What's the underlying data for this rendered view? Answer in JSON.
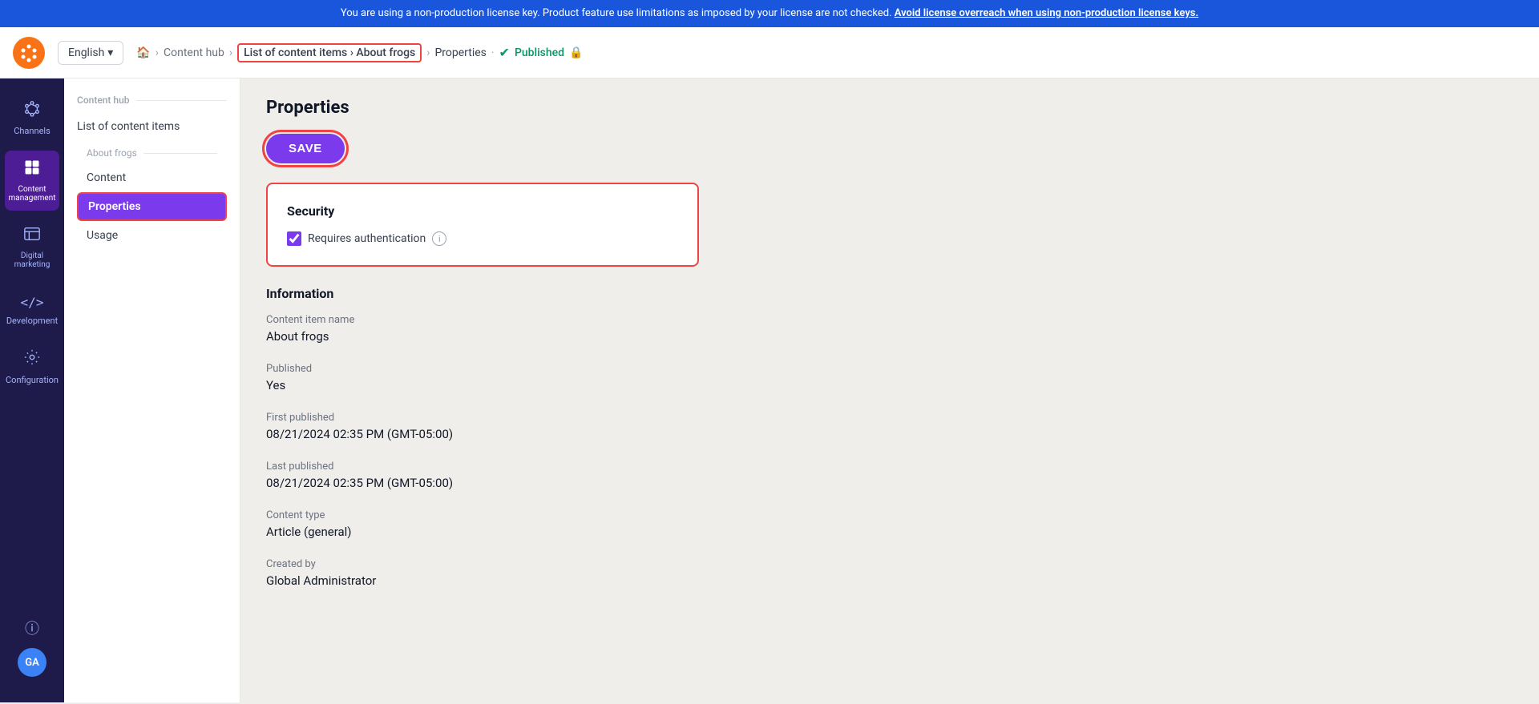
{
  "banner": {
    "text": "You are using a non-production license key. Product feature use limitations as imposed by your license are not checked.",
    "link_text": "Avoid license overreach when using non-production license keys."
  },
  "header": {
    "lang": "English",
    "lang_chevron": "▾",
    "breadcrumb": [
      {
        "label": "🏠",
        "type": "home"
      },
      {
        "label": "Content hub",
        "type": "link"
      },
      {
        "label": "List of content items",
        "type": "highlighted"
      },
      {
        "label": "About frogs",
        "type": "highlighted"
      },
      {
        "label": "Properties",
        "type": "current"
      }
    ],
    "published_label": "Published",
    "lock_icon": "🔒"
  },
  "sidebar": {
    "items": [
      {
        "id": "channels",
        "label": "Channels",
        "icon": "⊕"
      },
      {
        "id": "content-management",
        "label": "Content management",
        "icon": "▦",
        "active": true
      },
      {
        "id": "digital-marketing",
        "label": "Digital marketing",
        "icon": "▤"
      },
      {
        "id": "development",
        "label": "Development",
        "icon": "</>"
      },
      {
        "id": "configuration",
        "label": "Configuration",
        "icon": "⚙"
      }
    ],
    "bottom": {
      "info_icon": "ℹ",
      "avatar_initials": "GA"
    }
  },
  "sub_sidebar": {
    "top_label": "Content hub",
    "list_label": "List of content items",
    "item_label": "About frogs",
    "nav_items": [
      {
        "label": "Content",
        "active": false
      },
      {
        "label": "Properties",
        "active": true
      },
      {
        "label": "Usage",
        "active": false
      }
    ]
  },
  "main": {
    "page_title": "Properties",
    "save_button": "SAVE",
    "security": {
      "title": "Security",
      "checkbox_label": "Requires authentication",
      "checkbox_checked": true
    },
    "information": {
      "title": "Information",
      "fields": [
        {
          "label": "Content item name",
          "value": "About frogs"
        },
        {
          "label": "Published",
          "value": "Yes"
        },
        {
          "label": "First published",
          "value": "08/21/2024 02:35 PM (GMT-05:00)"
        },
        {
          "label": "Last published",
          "value": "08/21/2024 02:35 PM (GMT-05:00)"
        },
        {
          "label": "Content type",
          "value": "Article (general)"
        },
        {
          "label": "Created by",
          "value": "Global Administrator"
        }
      ]
    }
  }
}
